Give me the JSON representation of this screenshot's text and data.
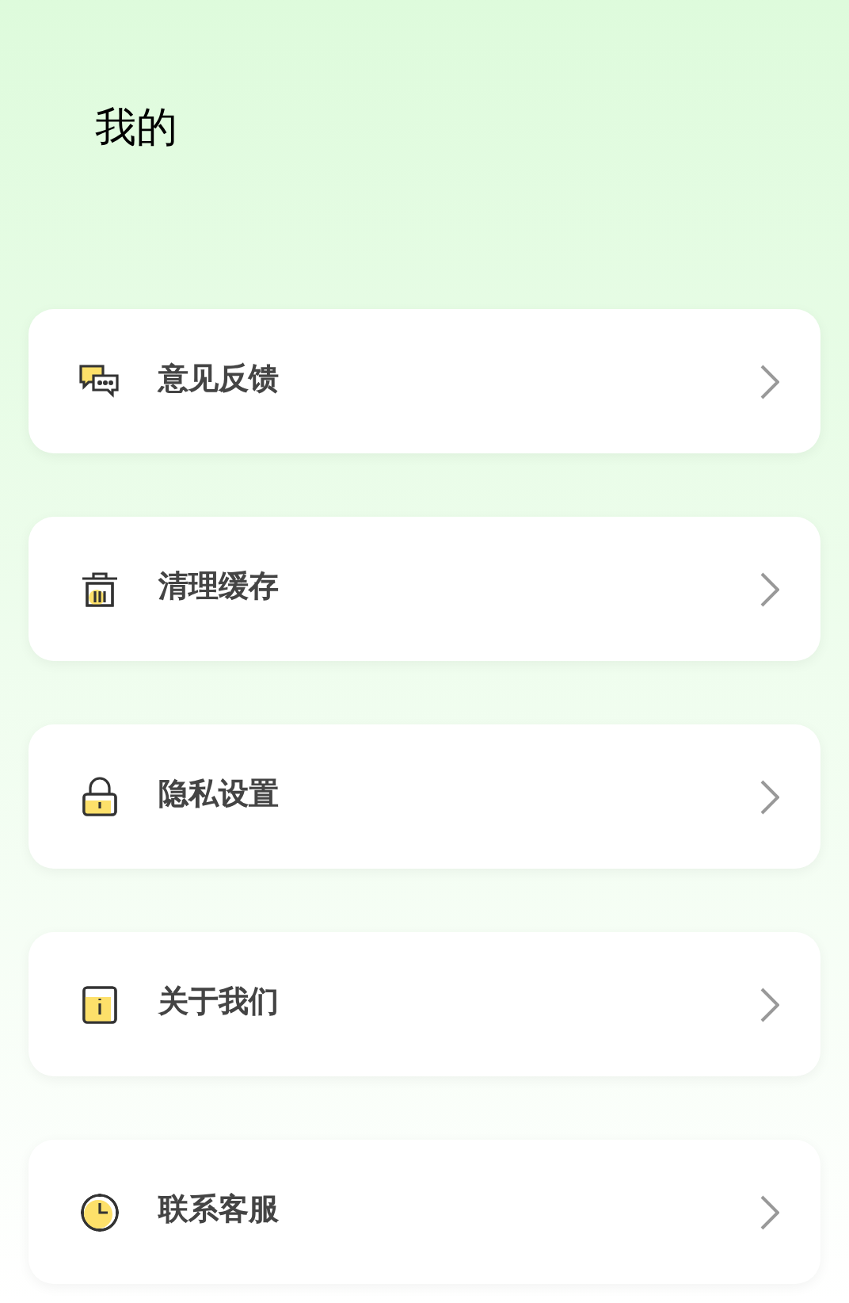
{
  "title": "我的",
  "menu": [
    {
      "kind": "feedback",
      "label": "意见反馈"
    },
    {
      "kind": "cache",
      "label": "清理缓存"
    },
    {
      "kind": "privacy",
      "label": "隐私设置"
    },
    {
      "kind": "about",
      "label": "关于我们"
    },
    {
      "kind": "service",
      "label": "联系客服"
    }
  ]
}
